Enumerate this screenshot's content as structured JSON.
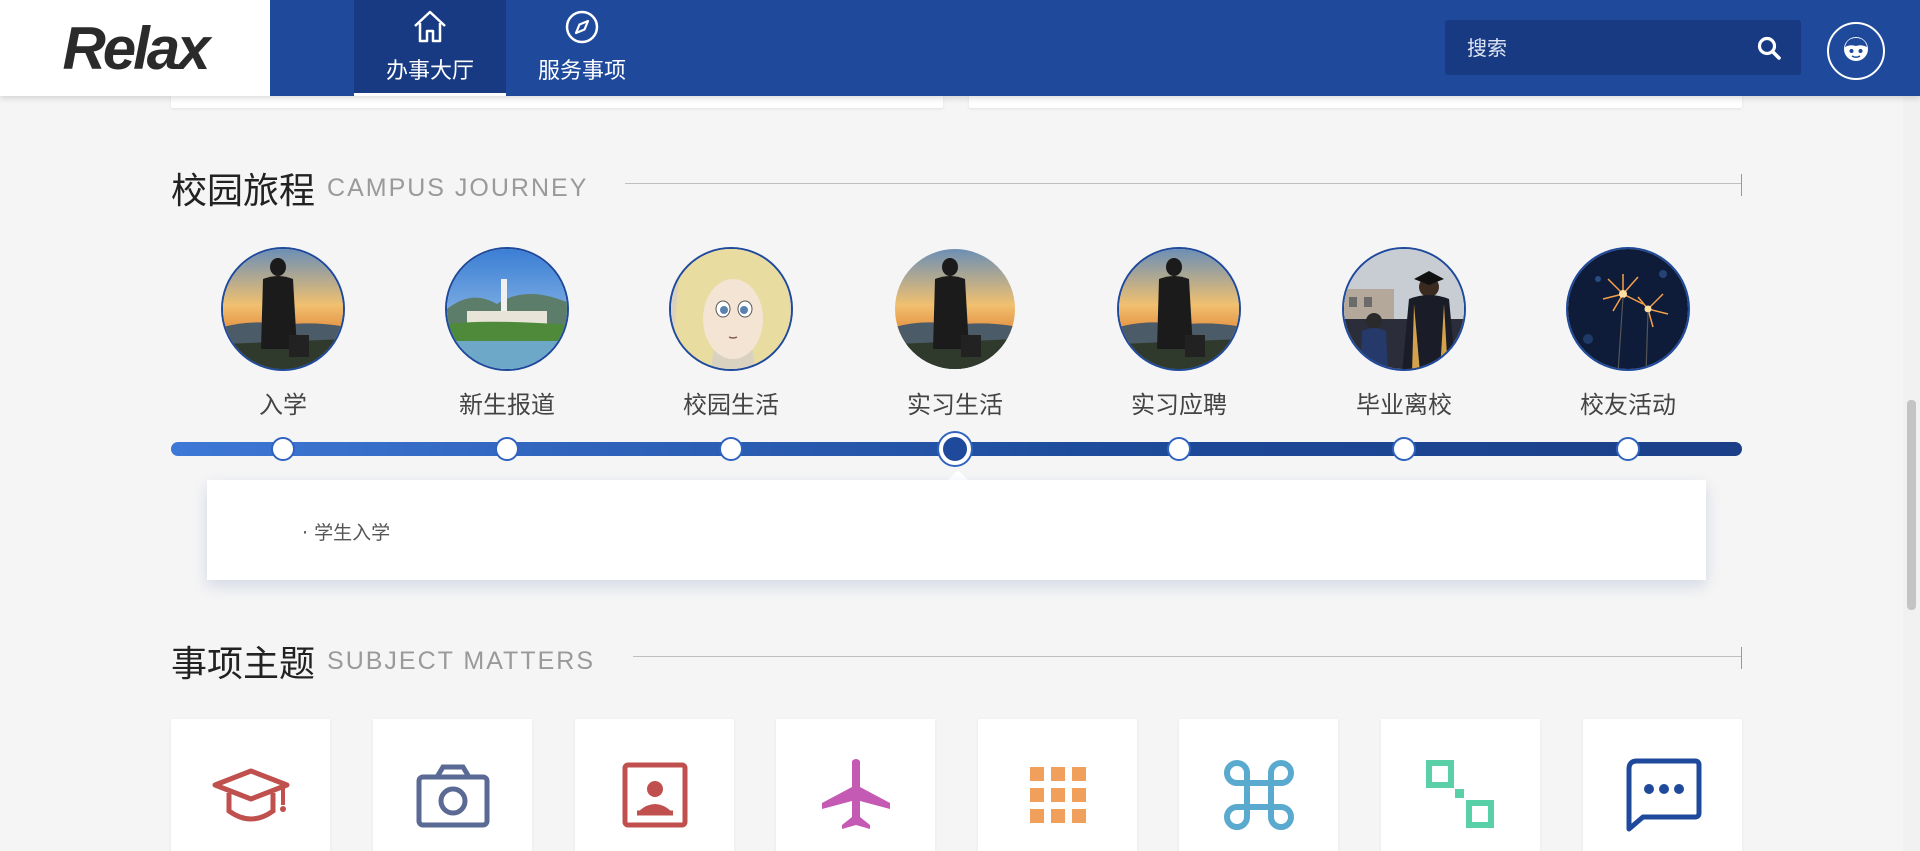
{
  "header": {
    "logo_text": "Relax",
    "nav": [
      {
        "label": "办事大厅",
        "icon": "home-icon",
        "active": true
      },
      {
        "label": "服务事项",
        "icon": "compass-icon",
        "active": false
      }
    ],
    "search": {
      "placeholder": "搜索",
      "icon": "search-icon"
    },
    "user_icon": "user-avatar-icon",
    "brand_color": "#1f4a9c"
  },
  "journey": {
    "title": "校园旅程",
    "subtitle": "CAMPUS JOURNEY",
    "stages": [
      {
        "label": "入学",
        "image": "silhouette-sunset"
      },
      {
        "label": "新生报道",
        "image": "campus-lake"
      },
      {
        "label": "校园生活",
        "image": "anime-character"
      },
      {
        "label": "实习生活",
        "image": "silhouette-sunset"
      },
      {
        "label": "实习应聘",
        "image": "silhouette-sunset"
      },
      {
        "label": "毕业离校",
        "image": "graduation-crowd"
      },
      {
        "label": "校友活动",
        "image": "fireworks"
      }
    ],
    "active_index": 3,
    "detail_item": "· 学生入学"
  },
  "subjects": {
    "title": "事项主题",
    "subtitle": "SUBJECT MATTERS",
    "tiles": [
      {
        "icon": "graduation-cap-icon",
        "color": "#c0504d"
      },
      {
        "icon": "camera-icon",
        "color": "#5a6a95"
      },
      {
        "icon": "portrait-icon",
        "color": "#c0504d"
      },
      {
        "icon": "airplane-icon",
        "color": "#c45ab3"
      },
      {
        "icon": "grid-icon",
        "color": "#f0a05a"
      },
      {
        "icon": "command-icon",
        "color": "#5aaacf"
      },
      {
        "icon": "connect-squares-icon",
        "color": "#5ad0a8"
      },
      {
        "icon": "chat-dots-icon",
        "color": "#1f4a9c"
      }
    ]
  }
}
